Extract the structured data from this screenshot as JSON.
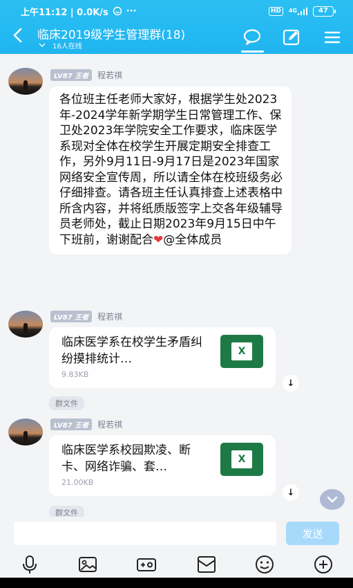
{
  "status_bar": {
    "time_speed": "上午11:12 | 0.0K/s",
    "dots": "···",
    "hd": "HD",
    "network": "4G",
    "battery": "47"
  },
  "header": {
    "title": "临床2019级学生管理群(18)",
    "online_count": "16人在线"
  },
  "messages": [
    {
      "level": "LV87 王者",
      "sender": "程若祺",
      "text": "各位班主任老师大家好，根据学生处2023年-2024学年新学期学生日常管理工作、保卫处2023年学院安全工作要求，临床医学系现对全体在校学生开展定期安全排查工作，另外9月11日-9月17日是2023年国家网络安全宣传周，所以请全体在校班级务必仔细排查。请各班主任认真排查上述表格中所含内容，并将纸质版签字上交各年级辅导员老师处，截止日期2023年9月15日中午下班前，谢谢配合",
      "heart": "❤",
      "mention": "@全体成员"
    },
    {
      "level": "LV87 王者",
      "sender": "程若祺",
      "file_name": "临床医学系在校学生矛盾纠纷摸排统计…",
      "file_size": "9.83KB",
      "file_type": "X",
      "tag": "群文件"
    },
    {
      "level": "LV87 王者",
      "sender": "程若祺",
      "file_name": "临床医学系校园欺凌、断卡、网络诈骗、套…",
      "file_size": "21.00KB",
      "file_type": "X",
      "tag": "群文件"
    }
  ],
  "input": {
    "placeholder": "",
    "send_label": "发送"
  },
  "toolbar_icons": [
    "microphone-icon",
    "image-icon",
    "red-packet-icon",
    "folder-icon",
    "emoji-icon",
    "plus-icon"
  ],
  "colors": {
    "header": "#20b5f0",
    "excel": "#1e7a45",
    "send_disabled": "#a7d9fb"
  }
}
